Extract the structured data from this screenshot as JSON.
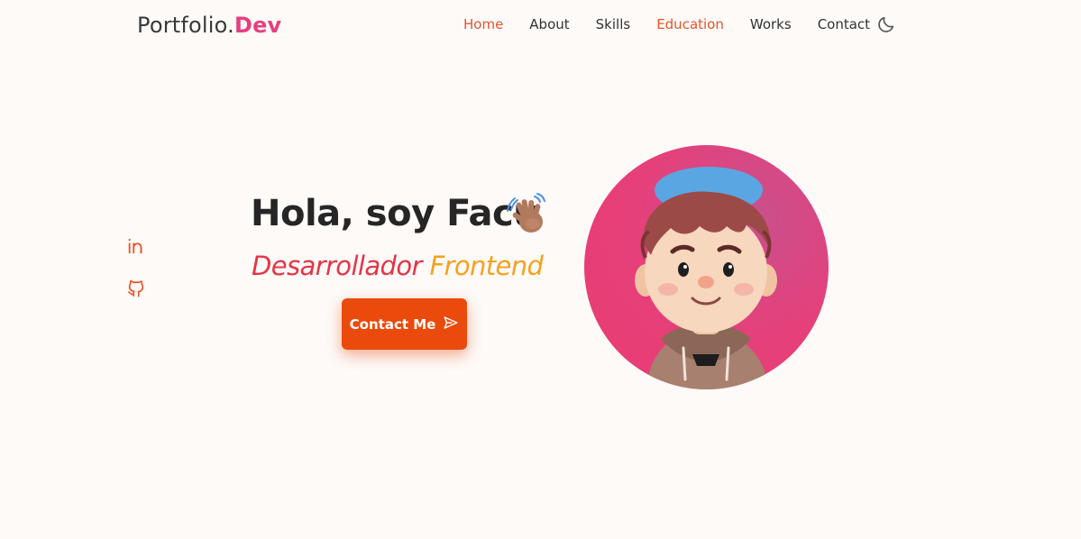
{
  "header": {
    "logo_main": "Portfolio",
    "logo_dot": ".",
    "logo_accent": "Dev",
    "nav": [
      {
        "label": "Home"
      },
      {
        "label": "About"
      },
      {
        "label": "Skills"
      },
      {
        "label": "Education"
      },
      {
        "label": "Works"
      },
      {
        "label": "Contact"
      }
    ],
    "theme_toggle_icon": "moon-icon"
  },
  "social": [
    {
      "icon": "linkedin-icon"
    },
    {
      "icon": "github-icon"
    }
  ],
  "hero": {
    "greeting": "Hola, soy Facu",
    "wave_icon": "waving-hand-icon",
    "subtitle_part1": "Desarrollador",
    "subtitle_part2": "Frontend",
    "cta_label": "Contact Me",
    "cta_icon": "send-icon"
  },
  "colors": {
    "accent_orange": "#ea4a0c",
    "accent_pink": "#e4407d",
    "background": "#fdfaf8"
  }
}
